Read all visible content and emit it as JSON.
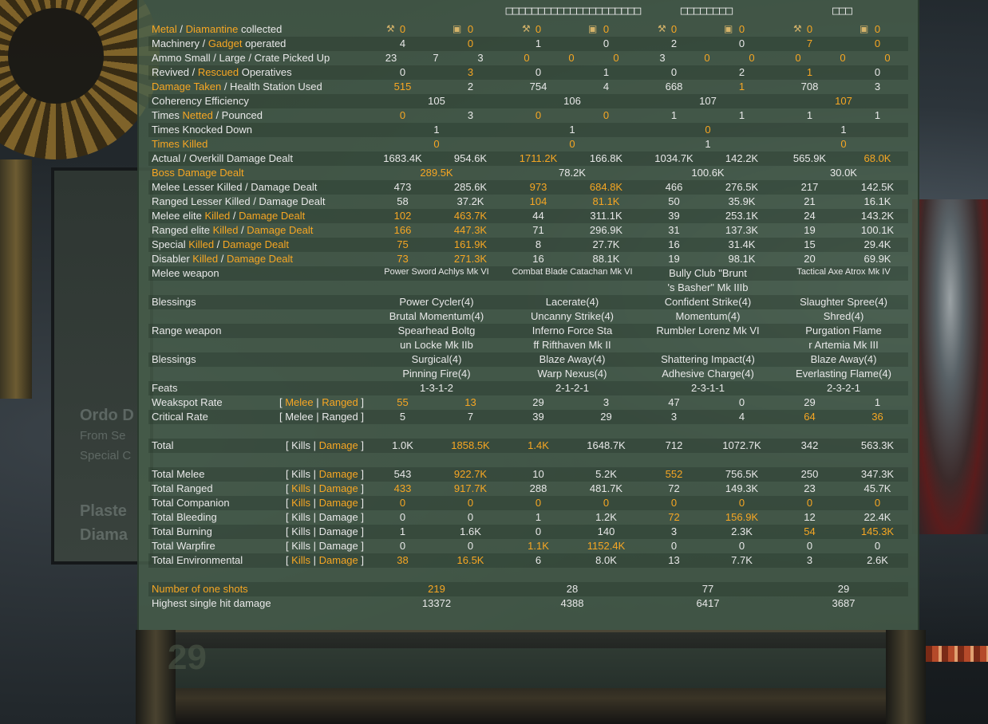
{
  "players": [
    "□□□□□□□□□□□□□□□□□□□□□",
    "□□□□□□□□",
    "□□□"
  ],
  "background": {
    "ordo": "Ordo D",
    "from": "From Se",
    "special": "Special C",
    "plaster": "Plaste",
    "diama": "Diama",
    "score": "29"
  },
  "colors": {
    "highlight": "#f6a623",
    "text": "#e8e8e8",
    "overlay": "#48604c"
  },
  "icons": [
    "wrench-icon",
    "crate-icon"
  ],
  "stats": [
    {
      "label": [
        [
          "Metal",
          "hl"
        ],
        [
          " / ",
          ""
        ],
        [
          "Diamantine",
          "hl"
        ],
        [
          " collected",
          ""
        ]
      ],
      "pairs": [
        [
          "0",
          "0",
          "hl",
          "hl"
        ],
        [
          "0",
          "0",
          "hl",
          "hl"
        ],
        [
          "0",
          "0",
          "hl",
          "hl"
        ],
        [
          "0",
          "0",
          "hl",
          "hl"
        ]
      ],
      "icons": true
    },
    {
      "label": [
        [
          "Machinery / ",
          ""
        ],
        [
          "Gadget",
          "hl"
        ],
        [
          " operated",
          ""
        ]
      ],
      "pairs": [
        [
          "4",
          "0",
          "",
          "hl"
        ],
        [
          "1",
          "0",
          "",
          ""
        ],
        [
          "2",
          "0",
          "",
          ""
        ],
        [
          "7",
          "0",
          "hl",
          "hl"
        ]
      ]
    },
    {
      "label": [
        [
          "Ammo Small / Large / Crate Picked Up",
          ""
        ]
      ],
      "triples": [
        [
          "23",
          "7",
          "3",
          "",
          "",
          ""
        ],
        [
          "0",
          "0",
          "0",
          "hl",
          "hl",
          "hl"
        ],
        [
          "3",
          "0",
          "0",
          "",
          "hl",
          "hl"
        ],
        [
          "0",
          "0",
          "0",
          "hl",
          "hl",
          "hl"
        ]
      ]
    },
    {
      "label": [
        [
          "Revived / ",
          ""
        ],
        [
          "Rescued",
          "hl"
        ],
        [
          " Operatives",
          ""
        ]
      ],
      "pairs": [
        [
          "0",
          "3",
          "",
          "hl"
        ],
        [
          "0",
          "1",
          "",
          ""
        ],
        [
          "0",
          "2",
          "",
          ""
        ],
        [
          "1",
          "0",
          "hl",
          ""
        ]
      ]
    },
    {
      "label": [
        [
          "Damage Taken",
          "hl"
        ],
        [
          " / Health Station Used",
          ""
        ]
      ],
      "pairs": [
        [
          "515",
          "2",
          "hl",
          ""
        ],
        [
          "754",
          "4",
          "",
          ""
        ],
        [
          "668",
          "1",
          "",
          "hl"
        ],
        [
          "708",
          "3",
          "",
          ""
        ]
      ]
    },
    {
      "label": [
        [
          "Coherency Efficiency",
          ""
        ]
      ],
      "singles": [
        [
          "105",
          ""
        ],
        [
          "106",
          ""
        ],
        [
          "107",
          ""
        ],
        [
          "107",
          "hl"
        ]
      ]
    },
    {
      "label": [
        [
          "Times ",
          ""
        ],
        [
          "Netted",
          "hl"
        ],
        [
          " / Pounced",
          ""
        ]
      ],
      "pairs": [
        [
          "0",
          "3",
          "hl",
          ""
        ],
        [
          "0",
          "0",
          "hl",
          "hl"
        ],
        [
          "1",
          "1",
          "",
          ""
        ],
        [
          "1",
          "1",
          "",
          ""
        ]
      ]
    },
    {
      "label": [
        [
          "Times Knocked Down",
          ""
        ]
      ],
      "singles": [
        [
          "1",
          ""
        ],
        [
          "1",
          ""
        ],
        [
          "0",
          "hl"
        ],
        [
          "1",
          ""
        ]
      ]
    },
    {
      "label": [
        [
          "Times Killed",
          "hl"
        ]
      ],
      "singles": [
        [
          "0",
          "hl"
        ],
        [
          "0",
          "hl"
        ],
        [
          "1",
          ""
        ],
        [
          "0",
          "hl"
        ]
      ]
    },
    {
      "label": [
        [
          "Actual / Overkill Damage Dealt",
          ""
        ]
      ],
      "pairs": [
        [
          "1683.4K",
          "954.6K",
          "",
          ""
        ],
        [
          "1711.2K",
          "166.8K",
          "hl",
          ""
        ],
        [
          "1034.7K",
          "142.2K",
          "",
          ""
        ],
        [
          "565.9K",
          "68.0K",
          "",
          "hl"
        ]
      ]
    },
    {
      "label": [
        [
          "Boss Damage Dealt",
          "hl"
        ]
      ],
      "singles": [
        [
          "289.5K",
          "hl"
        ],
        [
          "78.2K",
          ""
        ],
        [
          "100.6K",
          ""
        ],
        [
          "30.0K",
          ""
        ]
      ]
    },
    {
      "label": [
        [
          "Melee Lesser Killed / Damage Dealt",
          ""
        ]
      ],
      "pairs": [
        [
          "473",
          "285.6K",
          "",
          ""
        ],
        [
          "973",
          "684.8K",
          "hl",
          "hl"
        ],
        [
          "466",
          "276.5K",
          "",
          ""
        ],
        [
          "217",
          "142.5K",
          "",
          ""
        ]
      ]
    },
    {
      "label": [
        [
          "Ranged Lesser Killed / Damage Dealt",
          ""
        ]
      ],
      "pairs": [
        [
          "58",
          "37.2K",
          "",
          ""
        ],
        [
          "104",
          "81.1K",
          "hl",
          "hl"
        ],
        [
          "50",
          "35.9K",
          "",
          ""
        ],
        [
          "21",
          "16.1K",
          "",
          ""
        ]
      ]
    },
    {
      "label": [
        [
          "Melee elite ",
          ""
        ],
        [
          "Killed",
          "hl"
        ],
        [
          " / ",
          ""
        ],
        [
          "Damage Dealt",
          "hl"
        ]
      ],
      "pairs": [
        [
          "102",
          "463.7K",
          "hl",
          "hl"
        ],
        [
          "44",
          "311.1K",
          "",
          ""
        ],
        [
          "39",
          "253.1K",
          "",
          ""
        ],
        [
          "24",
          "143.2K",
          "",
          ""
        ]
      ]
    },
    {
      "label": [
        [
          "Ranged elite ",
          ""
        ],
        [
          "Killed",
          "hl"
        ],
        [
          " / ",
          ""
        ],
        [
          "Damage Dealt",
          "hl"
        ]
      ],
      "pairs": [
        [
          "166",
          "447.3K",
          "hl",
          "hl"
        ],
        [
          "71",
          "296.9K",
          "",
          ""
        ],
        [
          "31",
          "137.3K",
          "",
          ""
        ],
        [
          "19",
          "100.1K",
          "",
          ""
        ]
      ]
    },
    {
      "label": [
        [
          "Special ",
          ""
        ],
        [
          "Killed",
          "hl"
        ],
        [
          " / ",
          ""
        ],
        [
          "Damage Dealt",
          "hl"
        ]
      ],
      "pairs": [
        [
          "75",
          "161.9K",
          "hl",
          "hl"
        ],
        [
          "8",
          "27.7K",
          "",
          ""
        ],
        [
          "16",
          "31.4K",
          "",
          ""
        ],
        [
          "15",
          "29.4K",
          "",
          ""
        ]
      ]
    },
    {
      "label": [
        [
          "Disabler ",
          ""
        ],
        [
          "Killed",
          "hl"
        ],
        [
          " / ",
          ""
        ],
        [
          "Damage Dealt",
          "hl"
        ]
      ],
      "pairs": [
        [
          "73",
          "271.3K",
          "hl",
          "hl"
        ],
        [
          "16",
          "88.1K",
          "",
          ""
        ],
        [
          "19",
          "98.1K",
          "",
          ""
        ],
        [
          "20",
          "69.9K",
          "",
          ""
        ]
      ]
    },
    {
      "label": [
        [
          "Melee weapon",
          ""
        ]
      ],
      "singles": [
        [
          "Power Sword Achlys Mk VI",
          "small"
        ],
        [
          "Combat Blade Catachan Mk VI",
          "small"
        ],
        [
          "Bully Club \"Brunt",
          ""
        ],
        [
          "Tactical Axe Atrox Mk IV",
          "small"
        ]
      ]
    },
    {
      "label": [],
      "singles": [
        [
          "",
          ""
        ],
        [
          "",
          ""
        ],
        [
          "'s Basher\" Mk IIIb",
          ""
        ],
        [
          "",
          ""
        ]
      ]
    },
    {
      "label": [
        [
          "Blessings",
          ""
        ]
      ],
      "singles": [
        [
          "Power Cycler(4)",
          ""
        ],
        [
          "Lacerate(4)",
          ""
        ],
        [
          "Confident Strike(4)",
          ""
        ],
        [
          "Slaughter Spree(4)",
          ""
        ]
      ]
    },
    {
      "label": [],
      "singles": [
        [
          "Brutal Momentum(4)",
          ""
        ],
        [
          "Uncanny Strike(4)",
          ""
        ],
        [
          "Momentum(4)",
          ""
        ],
        [
          "Shred(4)",
          ""
        ]
      ]
    },
    {
      "label": [
        [
          "Range weapon",
          ""
        ]
      ],
      "singles": [
        [
          "Spearhead Boltg",
          ""
        ],
        [
          "Inferno Force Sta",
          ""
        ],
        [
          "Rumbler Lorenz Mk VI",
          ""
        ],
        [
          "Purgation Flame",
          ""
        ]
      ]
    },
    {
      "label": [],
      "singles": [
        [
          "un Locke Mk IIb",
          ""
        ],
        [
          "ff Rifthaven Mk II",
          ""
        ],
        [
          "",
          ""
        ],
        [
          "r Artemia Mk III",
          ""
        ]
      ]
    },
    {
      "label": [
        [
          "Blessings",
          ""
        ]
      ],
      "singles": [
        [
          "Surgical(4)",
          ""
        ],
        [
          "Blaze Away(4)",
          ""
        ],
        [
          "Shattering Impact(4)",
          ""
        ],
        [
          "Blaze Away(4)",
          ""
        ]
      ]
    },
    {
      "label": [],
      "singles": [
        [
          "Pinning Fire(4)",
          ""
        ],
        [
          "Warp Nexus(4)",
          ""
        ],
        [
          "Adhesive Charge(4)",
          ""
        ],
        [
          "Everlasting Flame(4)",
          ""
        ]
      ]
    },
    {
      "label": [
        [
          "Feats",
          ""
        ]
      ],
      "singles": [
        [
          "1-3-1-2",
          ""
        ],
        [
          "2-1-2-1",
          ""
        ],
        [
          "2-3-1-1",
          ""
        ],
        [
          "2-3-2-1",
          ""
        ]
      ]
    },
    {
      "label": [
        [
          "Weakspot Rate",
          ""
        ]
      ],
      "group": [
        [
          "[ ",
          ""
        ],
        [
          "Melee",
          "hl"
        ],
        [
          " | ",
          ""
        ],
        [
          "Ranged",
          "hl"
        ],
        [
          " ]",
          ""
        ]
      ],
      "pairs": [
        [
          "55",
          "13",
          "hl",
          "hl"
        ],
        [
          "29",
          "3",
          "",
          ""
        ],
        [
          "47",
          "0",
          "",
          ""
        ],
        [
          "29",
          "1",
          "",
          ""
        ]
      ]
    },
    {
      "label": [
        [
          "Critical Rate",
          ""
        ]
      ],
      "group": [
        [
          "[ Melee | Ranged ]",
          ""
        ]
      ],
      "pairs": [
        [
          "5",
          "7",
          "",
          ""
        ],
        [
          "39",
          "29",
          "",
          ""
        ],
        [
          "3",
          "4",
          "",
          ""
        ],
        [
          "64",
          "36",
          "hl",
          "hl"
        ]
      ]
    },
    {
      "label": [],
      "blank": true
    },
    {
      "label": [
        [
          "Total",
          ""
        ]
      ],
      "group": [
        [
          "[ Kills | ",
          ""
        ],
        [
          "Damage",
          "hl"
        ],
        [
          " ]",
          ""
        ]
      ],
      "pairs": [
        [
          "1.0K",
          "1858.5K",
          "",
          "hl"
        ],
        [
          "1.4K",
          "1648.7K",
          "hl",
          ""
        ],
        [
          "712",
          "1072.7K",
          "",
          ""
        ],
        [
          "342",
          "563.3K",
          "",
          ""
        ]
      ]
    },
    {
      "label": [],
      "blank": true
    },
    {
      "label": [
        [
          "Total Melee",
          ""
        ]
      ],
      "group": [
        [
          "[ Kills | ",
          ""
        ],
        [
          "Damage",
          "hl"
        ],
        [
          " ]",
          ""
        ]
      ],
      "pairs": [
        [
          "543",
          "922.7K",
          "",
          "hl"
        ],
        [
          "10",
          "5.2K",
          "",
          ""
        ],
        [
          "552",
          "756.5K",
          "hl",
          ""
        ],
        [
          "250",
          "347.3K",
          "",
          ""
        ]
      ]
    },
    {
      "label": [
        [
          "Total Ranged",
          ""
        ]
      ],
      "group": [
        [
          "[ ",
          ""
        ],
        [
          "Kills",
          "hl"
        ],
        [
          " | ",
          ""
        ],
        [
          "Damage",
          "hl"
        ],
        [
          " ]",
          ""
        ]
      ],
      "pairs": [
        [
          "433",
          "917.7K",
          "hl",
          "hl"
        ],
        [
          "288",
          "481.7K",
          "",
          ""
        ],
        [
          "72",
          "149.3K",
          "",
          ""
        ],
        [
          "23",
          "45.7K",
          "",
          ""
        ]
      ]
    },
    {
      "label": [
        [
          "Total Companion",
          ""
        ]
      ],
      "group": [
        [
          "[ ",
          ""
        ],
        [
          "Kills",
          "hl"
        ],
        [
          " | ",
          ""
        ],
        [
          "Damage",
          "hl"
        ],
        [
          " ]",
          ""
        ]
      ],
      "pairs": [
        [
          "0",
          "0",
          "hl",
          "hl"
        ],
        [
          "0",
          "0",
          "hl",
          "hl"
        ],
        [
          "0",
          "0",
          "hl",
          "hl"
        ],
        [
          "0",
          "0",
          "hl",
          "hl"
        ]
      ]
    },
    {
      "label": [
        [
          "Total Bleeding",
          ""
        ]
      ],
      "group": [
        [
          "[ Kills | Damage ]",
          ""
        ]
      ],
      "pairs": [
        [
          "0",
          "0",
          "",
          ""
        ],
        [
          "1",
          "1.2K",
          "",
          ""
        ],
        [
          "72",
          "156.9K",
          "hl",
          "hl"
        ],
        [
          "12",
          "22.4K",
          "",
          ""
        ]
      ]
    },
    {
      "label": [
        [
          "Total Burning",
          ""
        ]
      ],
      "group": [
        [
          "[ Kills | Damage ]",
          ""
        ]
      ],
      "pairs": [
        [
          "1",
          "1.6K",
          "",
          ""
        ],
        [
          "0",
          "140",
          "",
          ""
        ],
        [
          "3",
          "2.3K",
          "",
          ""
        ],
        [
          "54",
          "145.3K",
          "hl",
          "hl"
        ]
      ]
    },
    {
      "label": [
        [
          "Total Warpfire",
          ""
        ]
      ],
      "group": [
        [
          "[ Kills | Damage ]",
          ""
        ]
      ],
      "pairs": [
        [
          "0",
          "0",
          "",
          ""
        ],
        [
          "1.1K",
          "1152.4K",
          "hl",
          "hl"
        ],
        [
          "0",
          "0",
          "",
          ""
        ],
        [
          "0",
          "0",
          "",
          ""
        ]
      ]
    },
    {
      "label": [
        [
          "Total Environmental",
          ""
        ]
      ],
      "group": [
        [
          "[ ",
          ""
        ],
        [
          "Kills",
          "hl"
        ],
        [
          " | ",
          ""
        ],
        [
          "Damage",
          "hl"
        ],
        [
          " ]",
          ""
        ]
      ],
      "pairs": [
        [
          "38",
          "16.5K",
          "hl",
          "hl"
        ],
        [
          "6",
          "8.0K",
          "",
          ""
        ],
        [
          "13",
          "7.7K",
          "",
          ""
        ],
        [
          "3",
          "2.6K",
          "",
          ""
        ]
      ]
    },
    {
      "label": [],
      "blank": true
    },
    {
      "label": [
        [
          "Number of one shots",
          "hl"
        ]
      ],
      "singles": [
        [
          "219",
          "hl"
        ],
        [
          "28",
          ""
        ],
        [
          "77",
          ""
        ],
        [
          "29",
          ""
        ]
      ]
    },
    {
      "label": [
        [
          "Highest single hit damage",
          ""
        ]
      ],
      "singles": [
        [
          "13372",
          ""
        ],
        [
          "4388",
          ""
        ],
        [
          "6417",
          ""
        ],
        [
          "3687",
          ""
        ]
      ]
    }
  ]
}
